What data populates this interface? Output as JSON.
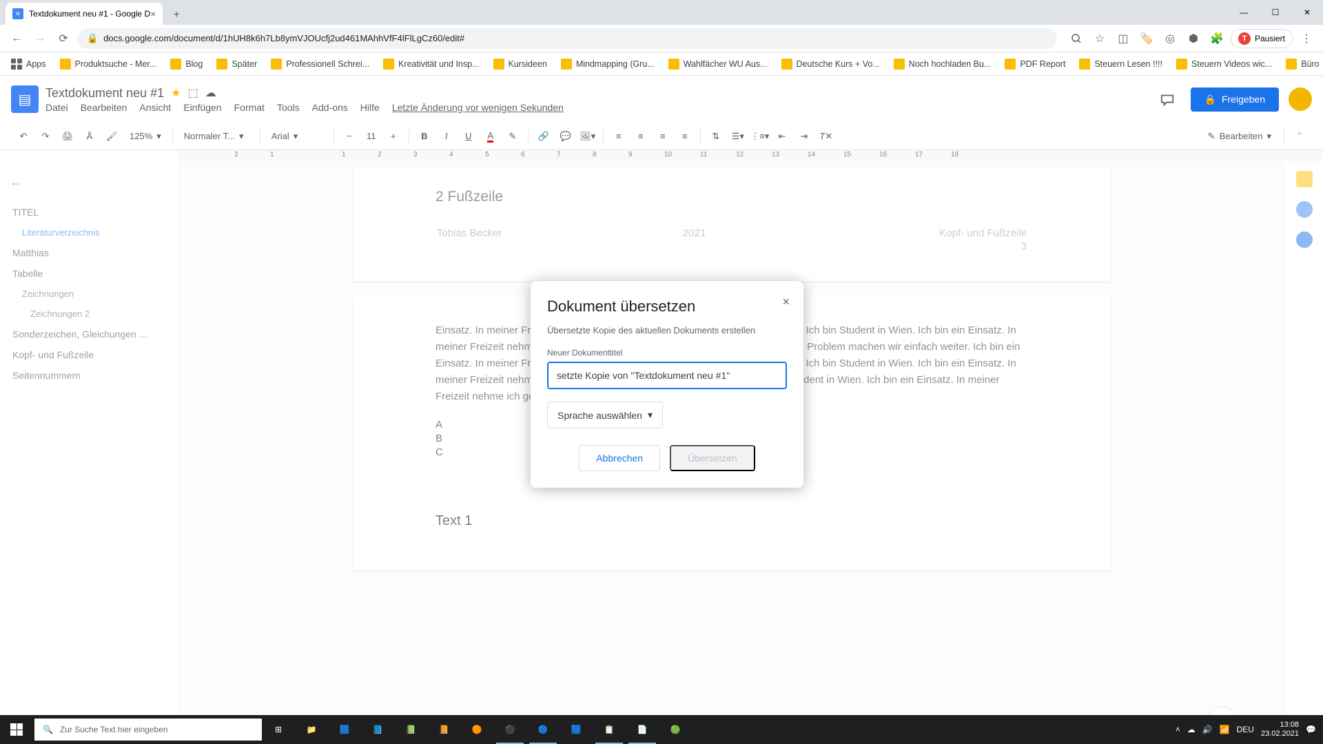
{
  "browser": {
    "tab_title": "Textdokument neu #1 - Google D",
    "url": "docs.google.com/document/d/1hUH8k6h7Lb8ymVJOUcfj2ud461MAhhVfF4lFlLgCz60/edit#",
    "paused_label": "Pausiert"
  },
  "bookmarks": {
    "apps": "Apps",
    "items": [
      "Produktsuche - Mer...",
      "Blog",
      "Später",
      "Professionell Schrei...",
      "Kreativität und Insp...",
      "Kursideen",
      "Mindmapping (Gru...",
      "Wahlfächer WU Aus...",
      "Deutsche Kurs + Vo...",
      "Noch hochladen Bu...",
      "PDF Report",
      "Steuern Lesen !!!!",
      "Steuern Videos wic...",
      "Büro"
    ]
  },
  "docs": {
    "title": "Textdokument neu #1",
    "menus": [
      "Datei",
      "Bearbeiten",
      "Ansicht",
      "Einfügen",
      "Format",
      "Tools",
      "Add-ons",
      "Hilfe"
    ],
    "last_edit": "Letzte Änderung vor wenigen Sekunden",
    "share": "Freigeben"
  },
  "toolbar": {
    "zoom": "125%",
    "style": "Normaler T...",
    "font": "Arial",
    "size": "11",
    "edit_mode": "Bearbeiten"
  },
  "ruler": {
    "marks": [
      "2",
      "1",
      "",
      "1",
      "2",
      "3",
      "4",
      "5",
      "6",
      "7",
      "8",
      "9",
      "10",
      "11",
      "12",
      "13",
      "14",
      "15",
      "16",
      "17",
      "18"
    ]
  },
  "outline": {
    "items": [
      {
        "label": "TITEL",
        "level": 1
      },
      {
        "label": "Literaturverzeichnis",
        "level": 2,
        "active": true
      },
      {
        "label": "Matthias",
        "level": 1
      },
      {
        "label": "Tabelle",
        "level": 1
      },
      {
        "label": "Zeichnungen",
        "level": 2
      },
      {
        "label": "Zeichnungen 2",
        "level": 3
      },
      {
        "label": "Sonderzeichen, Gleichungen ...",
        "level": 1
      },
      {
        "label": "Kopf- und Fußzeile",
        "level": 1
      },
      {
        "label": "Seitennummern",
        "level": 1
      }
    ]
  },
  "document": {
    "section_heading": "2 Fußzeile",
    "footer": {
      "author": "Tobias Becker",
      "year": "2021",
      "title": "Kopf- und Fußzeile",
      "page": "3"
    },
    "body": "Einsatz. In meiner Freizeit nehme ich gerne Videos auf. Mein Name ist Matthias. Ich bin Student in Wien. Ich bin ein Einsatz. In meiner Freizeit nehme ich gerne Videos auf. Fehler machen ist menschlich. Kein Problem machen wir einfach weiter. Ich bin ein Einsatz. In meiner Freizeit nehme ich gerne Videos auf. Mein Name ist Matthias. Ich bin Student in Wien. Ich bin ein Einsatz. In meiner Freizeit nehme ich gerne Videos auf. Mein Name ist Matthias. Ich bin Student in Wien. Ich bin ein Einsatz. In meiner Freizeit nehme ich gerne Videos auf.",
    "list": [
      "A",
      "B",
      "C"
    ],
    "text_heading": "Text 1"
  },
  "modal": {
    "title": "Dokument übersetzen",
    "desc": "Übersetzte Kopie des aktuellen Dokuments erstellen",
    "input_label": "Neuer Dokumenttitel",
    "input_value": "setzte Kopie von \"Textdokument neu #1\"",
    "select_label": "Sprache auswählen",
    "cancel": "Abbrechen",
    "submit": "Übersetzen"
  },
  "taskbar": {
    "search_placeholder": "Zur Suche Text hier eingeben",
    "time": "13:08",
    "date": "23.02.2021",
    "lang": "DEU"
  }
}
